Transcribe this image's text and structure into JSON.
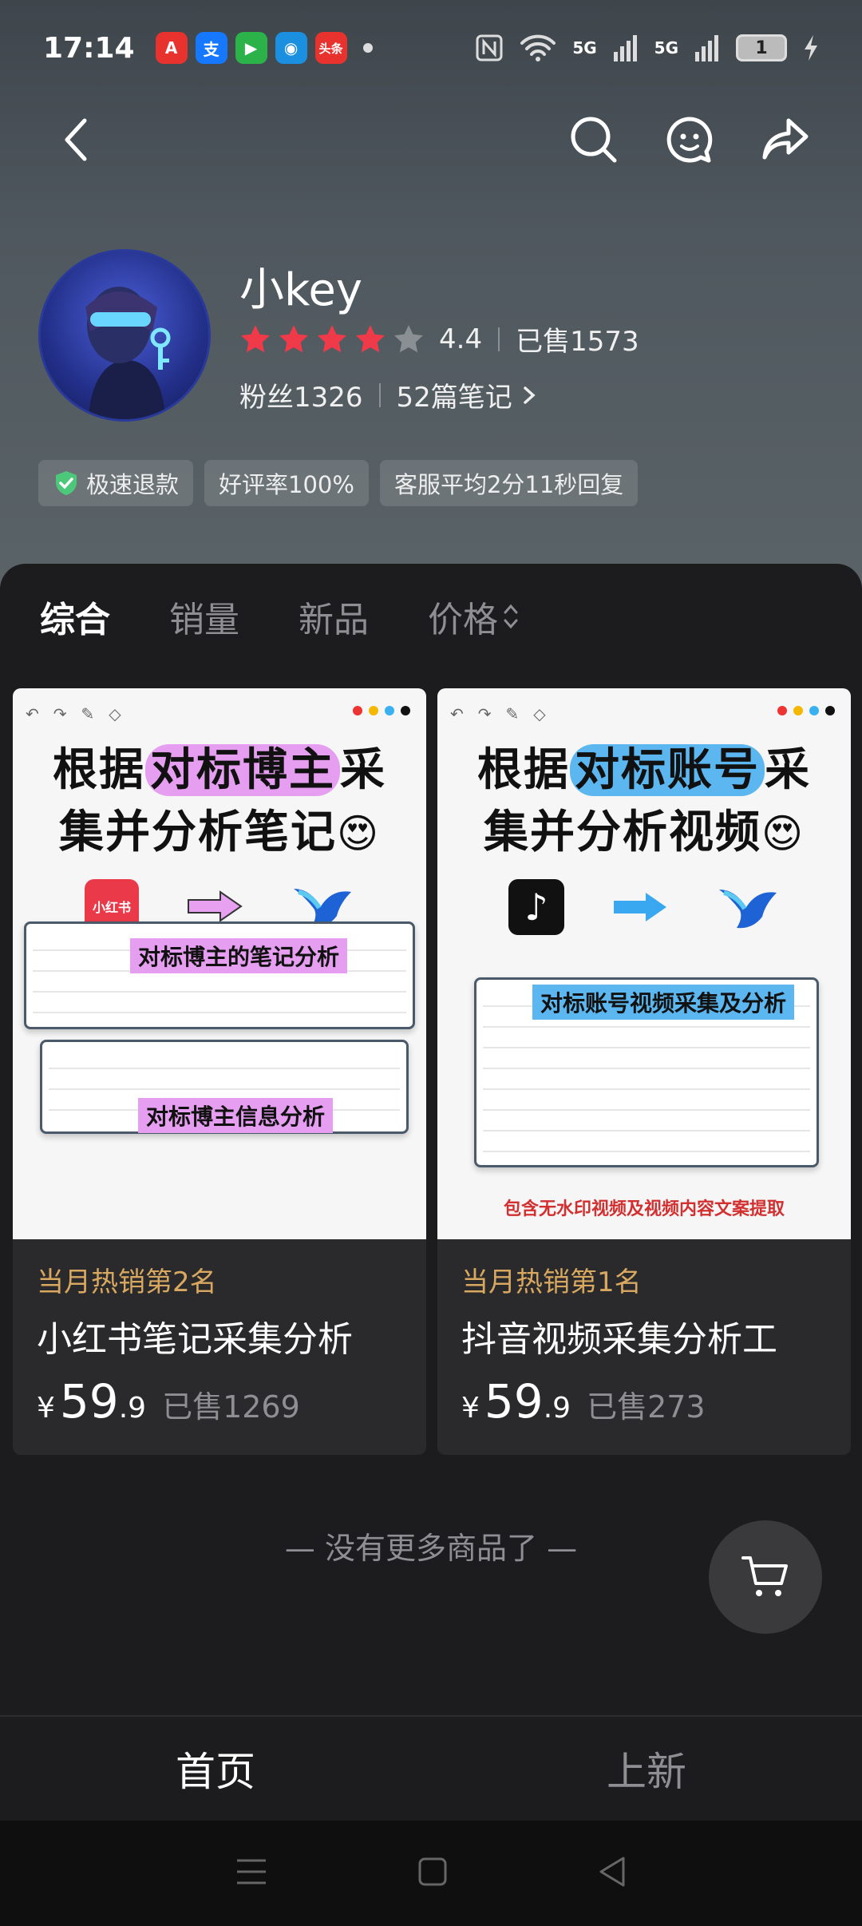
{
  "status_bar": {
    "time": "17:14",
    "apps": [
      {
        "name": "app-a-icon",
        "text": "A",
        "color": "#e8322e"
      },
      {
        "name": "alipay-icon",
        "text": "支",
        "color": "#1677ff"
      },
      {
        "name": "app-play-icon",
        "text": "▶",
        "color": "#2bb34a"
      },
      {
        "name": "china-mobile-icon",
        "text": "◉",
        "color": "#1b8fe0"
      },
      {
        "name": "toutiao-icon",
        "text": "头条",
        "color": "#e8322e"
      }
    ],
    "network_5g_1": "5G",
    "network_5g_2": "5G",
    "battery": "1"
  },
  "shop": {
    "name": "小key",
    "rating": "4.4",
    "rating_stars": 4.4,
    "sold": "已售1573",
    "fans": "粉丝1326",
    "notes": "52篇笔记"
  },
  "chips": {
    "fast_refund": "极速退款",
    "positive_rate": "好评率100%",
    "service": "客服平均2分11秒回复"
  },
  "sort_tabs": [
    "综合",
    "销量",
    "新品",
    "价格"
  ],
  "products": [
    {
      "headline_1a": "根据",
      "headline_1b": "对标博主",
      "headline_1c": "采",
      "headline_2": "集并分析笔记",
      "logo_text": "小红书",
      "tag_1": "对标博主的笔记分析",
      "tag_2": "对标博主信息分析",
      "rank": "当月热销第2名",
      "title": "小红书笔记采集分析",
      "currency": "¥",
      "price_int": "59",
      "price_dec": ".9",
      "sold": "已售1269"
    },
    {
      "headline_1a": "根据",
      "headline_1b": "对标账号",
      "headline_1c": "采",
      "headline_2": "集并分析视频",
      "tag_1": "对标账号视频采集及分析",
      "note": "包含无水印视频及视频内容文案提取",
      "rank": "当月热销第1名",
      "title": "抖音视频采集分析工",
      "currency": "¥",
      "price_int": "59",
      "price_dec": ".9",
      "sold": "已售273"
    }
  ],
  "no_more": "— 没有更多商品了 —",
  "bottom_tabs": [
    "首页",
    "上新"
  ],
  "colors": {
    "star": "#f03a4a",
    "rank": "#d8a860",
    "highlight_pink": "#e59ef0",
    "highlight_blue": "#5cb6ef"
  }
}
